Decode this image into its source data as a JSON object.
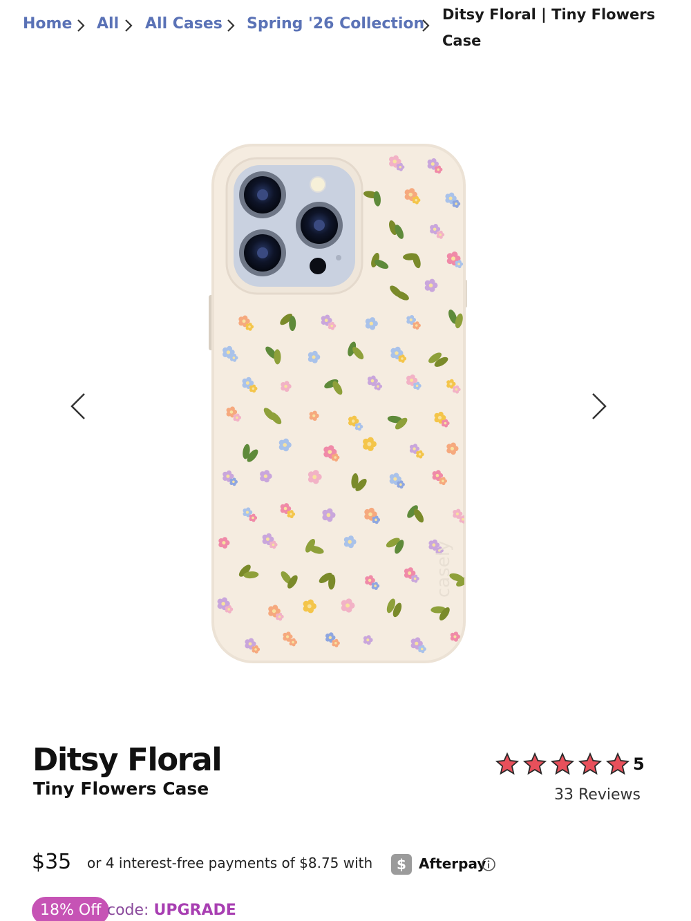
{
  "breadcrumb": {
    "items": [
      {
        "label": "Home"
      },
      {
        "label": "All"
      },
      {
        "label": "All Cases"
      },
      {
        "label": "Spring '26 Collection"
      }
    ],
    "current": "Ditsy Floral | Tiny Flowers Case"
  },
  "gallery": {
    "prev_icon": "chevron-left-icon",
    "next_icon": "chevron-right-icon",
    "image_brand_text": "casely"
  },
  "product": {
    "title": "Ditsy Floral",
    "subtitle": "Tiny Flowers Case",
    "rating": {
      "value": "5",
      "stars": 5,
      "star_color": "#e8505b",
      "reviews_label": "33 Reviews"
    },
    "price": "$35",
    "installments": {
      "text": "or 4 interest-free payments of $8.75 with",
      "badge_glyph": "$",
      "provider": "Afterpay",
      "info_icon": "info-icon"
    },
    "promo": {
      "badge": "18% Off",
      "code_prefix": "code:",
      "code": "UPGRADE",
      "badge_color": "#c653b5"
    }
  },
  "colors": {
    "link": "#5a72b6",
    "case_background": "#f5ece0"
  }
}
